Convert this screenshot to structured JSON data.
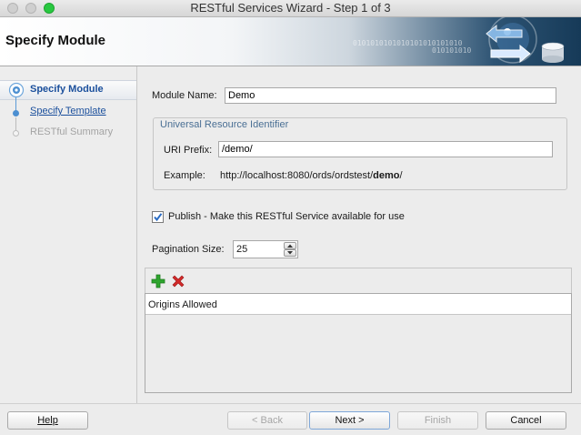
{
  "window": {
    "title": "RESTful Services Wizard - Step 1 of 3"
  },
  "header": {
    "title": "Specify Module",
    "binary_text_1": "0101010101010101010101010",
    "binary_text_2": "010101010"
  },
  "nav": {
    "items": [
      {
        "label": "Specify Module",
        "state": "current"
      },
      {
        "label": "Specify Template",
        "state": "link"
      },
      {
        "label": "RESTful Summary",
        "state": "disabled"
      }
    ]
  },
  "form": {
    "module_name_label": "Module Name:",
    "module_name_value": "Demo",
    "uri_group_title": "Universal Resource Identifier",
    "uri_prefix_label": "URI Prefix:",
    "uri_prefix_value": "/demo/",
    "example_label": "Example:",
    "example_url_prefix": "http://localhost:8080/ords/ordstest/",
    "example_url_bold": "demo",
    "example_url_suffix": "/",
    "publish_label": "Publish - Make this RESTful Service available for use",
    "publish_checked": true,
    "pagination_label": "Pagination Size:",
    "pagination_value": "25"
  },
  "origins": {
    "add_icon": "plus-icon",
    "remove_icon": "x-icon",
    "column_header": "Origins Allowed",
    "rows": []
  },
  "buttons": {
    "help": "Help",
    "back": "< Back",
    "next": "Next >",
    "finish": "Finish",
    "cancel": "Cancel"
  },
  "colors": {
    "link": "#1a4f9c",
    "legend": "#4a6f94",
    "add_green": "#2ea52e",
    "remove_red": "#d22a2a"
  }
}
